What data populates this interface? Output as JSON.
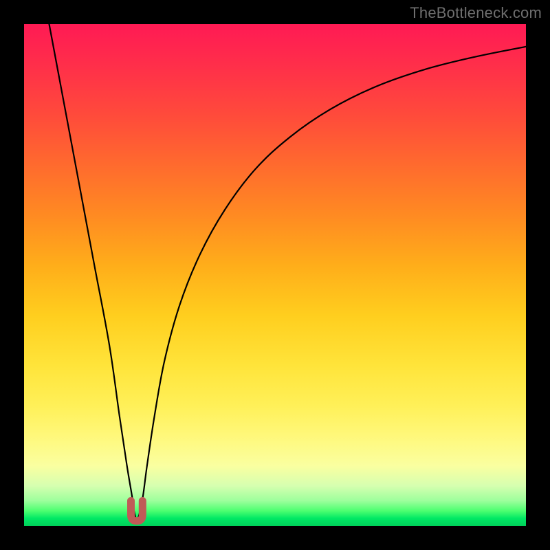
{
  "watermark": "TheBottleneck.com",
  "colors": {
    "frame": "#000000",
    "curve": "#000000",
    "marker_fill": "#c05a57",
    "marker_stroke": "#b04e4b"
  },
  "chart_data": {
    "type": "line",
    "title": "",
    "xlabel": "",
    "ylabel": "",
    "xlim": [
      0,
      100
    ],
    "ylim": [
      0,
      100
    ],
    "grid": false,
    "legend": false,
    "series": [
      {
        "name": "bottleneck-curve",
        "x": [
          5,
          8,
          11,
          14,
          17,
          19,
          20.5,
          21.5,
          22,
          22.5,
          23,
          23.7,
          24.5,
          26,
          28,
          31,
          35,
          40,
          46,
          53,
          61,
          70,
          80,
          90,
          100
        ],
        "y": [
          100,
          84,
          68,
          52,
          36,
          22,
          12,
          6,
          2.5,
          1.3,
          2.5,
          6,
          12,
          22,
          33,
          44,
          54,
          63,
          71,
          77.5,
          83,
          87.5,
          91,
          93.5,
          95.5
        ]
      }
    ],
    "minimum_marker": {
      "x_range": [
        21.3,
        23.6
      ],
      "y_range": [
        1.0,
        5.0
      ],
      "shape": "U"
    },
    "background_gradient": {
      "orientation": "vertical",
      "stops": [
        {
          "pos": 0.0,
          "color": "#ff1a54"
        },
        {
          "pos": 0.5,
          "color": "#ffce1e"
        },
        {
          "pos": 0.82,
          "color": "#fff87a"
        },
        {
          "pos": 0.95,
          "color": "#9cff9c"
        },
        {
          "pos": 1.0,
          "color": "#00d05a"
        }
      ]
    }
  }
}
